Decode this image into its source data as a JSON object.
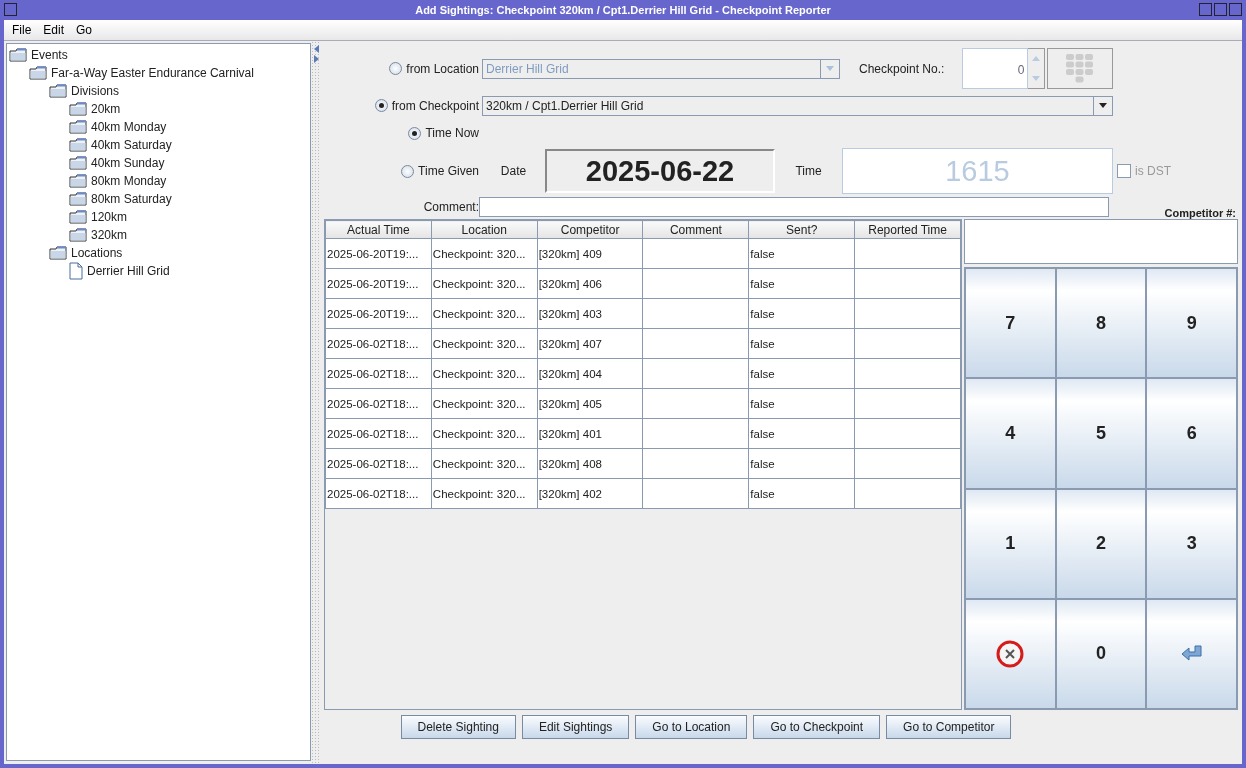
{
  "window": {
    "title": "Add Sightings: Checkpoint 320km / Cpt1.Derrier Hill Grid - Checkpoint Reporter"
  },
  "menu": [
    {
      "label": "File"
    },
    {
      "label": "Edit"
    },
    {
      "label": "Go"
    }
  ],
  "tree": {
    "label": "Events",
    "kind": "folder",
    "children": [
      {
        "label": "Far-a-Way Easter Endurance Carnival",
        "kind": "folder",
        "children": [
          {
            "label": "Divisions",
            "kind": "folder",
            "children": [
              {
                "label": "20km",
                "kind": "folder"
              },
              {
                "label": "40km Monday",
                "kind": "folder"
              },
              {
                "label": "40km Saturday",
                "kind": "folder"
              },
              {
                "label": "40km Sunday",
                "kind": "folder"
              },
              {
                "label": "80km Monday",
                "kind": "folder"
              },
              {
                "label": "80km Saturday",
                "kind": "folder"
              },
              {
                "label": "120km",
                "kind": "folder"
              },
              {
                "label": "320km",
                "kind": "folder"
              }
            ]
          },
          {
            "label": "Locations",
            "kind": "folder",
            "children": [
              {
                "label": "Derrier Hill Grid",
                "kind": "file"
              }
            ]
          }
        ]
      }
    ]
  },
  "source": [
    {
      "label": "from Location",
      "selected": false,
      "value": "Derrier Hill Grid",
      "disabled": true
    },
    {
      "label": "from Checkpoint",
      "selected": true,
      "value": "320km / Cpt1.Derrier Hill Grid",
      "disabled": false
    }
  ],
  "checkpoint_no": {
    "label": "Checkpoint No.:",
    "value": "0"
  },
  "time_mode": [
    {
      "label": "Time Now",
      "selected": true
    },
    {
      "label": "Time Given",
      "selected": false
    }
  ],
  "date": {
    "label": "Date",
    "value": "2025-06-22"
  },
  "time": {
    "label": "Time",
    "value": "1615",
    "disabled": true
  },
  "dst": {
    "label": "is DST",
    "checked": false,
    "disabled": true
  },
  "comment": {
    "label": "Comment:"
  },
  "table": {
    "columns": [
      "Actual Time",
      "Location",
      "Competitor",
      "Comment",
      "Sent?",
      "Reported Time"
    ],
    "rows": [
      {
        "actual_time": "2025-06-20T19:...",
        "location": "Checkpoint: 320...",
        "competitor": "[320km] 409",
        "sent": "false"
      },
      {
        "actual_time": "2025-06-20T19:...",
        "location": "Checkpoint: 320...",
        "competitor": "[320km] 406",
        "sent": "false"
      },
      {
        "actual_time": "2025-06-20T19:...",
        "location": "Checkpoint: 320...",
        "competitor": "[320km] 403",
        "sent": "false"
      },
      {
        "actual_time": "2025-06-02T18:...",
        "location": "Checkpoint: 320...",
        "competitor": "[320km] 407",
        "sent": "false"
      },
      {
        "actual_time": "2025-06-02T18:...",
        "location": "Checkpoint: 320...",
        "competitor": "[320km] 404",
        "sent": "false"
      },
      {
        "actual_time": "2025-06-02T18:...",
        "location": "Checkpoint: 320...",
        "competitor": "[320km] 405",
        "sent": "false"
      },
      {
        "actual_time": "2025-06-02T18:...",
        "location": "Checkpoint: 320...",
        "competitor": "[320km] 401",
        "sent": "false"
      },
      {
        "actual_time": "2025-06-02T18:...",
        "location": "Checkpoint: 320...",
        "competitor": "[320km] 408",
        "sent": "false"
      },
      {
        "actual_time": "2025-06-02T18:...",
        "location": "Checkpoint: 320...",
        "competitor": "[320km] 402",
        "sent": "false"
      }
    ]
  },
  "keypad": {
    "label": "Competitor #:",
    "keys": [
      {
        "kind": "digit",
        "label": "7"
      },
      {
        "kind": "digit",
        "label": "8"
      },
      {
        "kind": "digit",
        "label": "9"
      },
      {
        "kind": "digit",
        "label": "4"
      },
      {
        "kind": "digit",
        "label": "5"
      },
      {
        "kind": "digit",
        "label": "6"
      },
      {
        "kind": "digit",
        "label": "1"
      },
      {
        "kind": "digit",
        "label": "2"
      },
      {
        "kind": "digit",
        "label": "3"
      },
      {
        "kind": "clear"
      },
      {
        "kind": "digit",
        "label": "0"
      },
      {
        "kind": "enter"
      }
    ]
  },
  "buttons": [
    {
      "label": "Delete Sighting"
    },
    {
      "label": "Edit Sightings"
    },
    {
      "label": "Go to Location"
    },
    {
      "label": "Go to Checkpoint"
    },
    {
      "label": "Go to Competitor"
    }
  ]
}
